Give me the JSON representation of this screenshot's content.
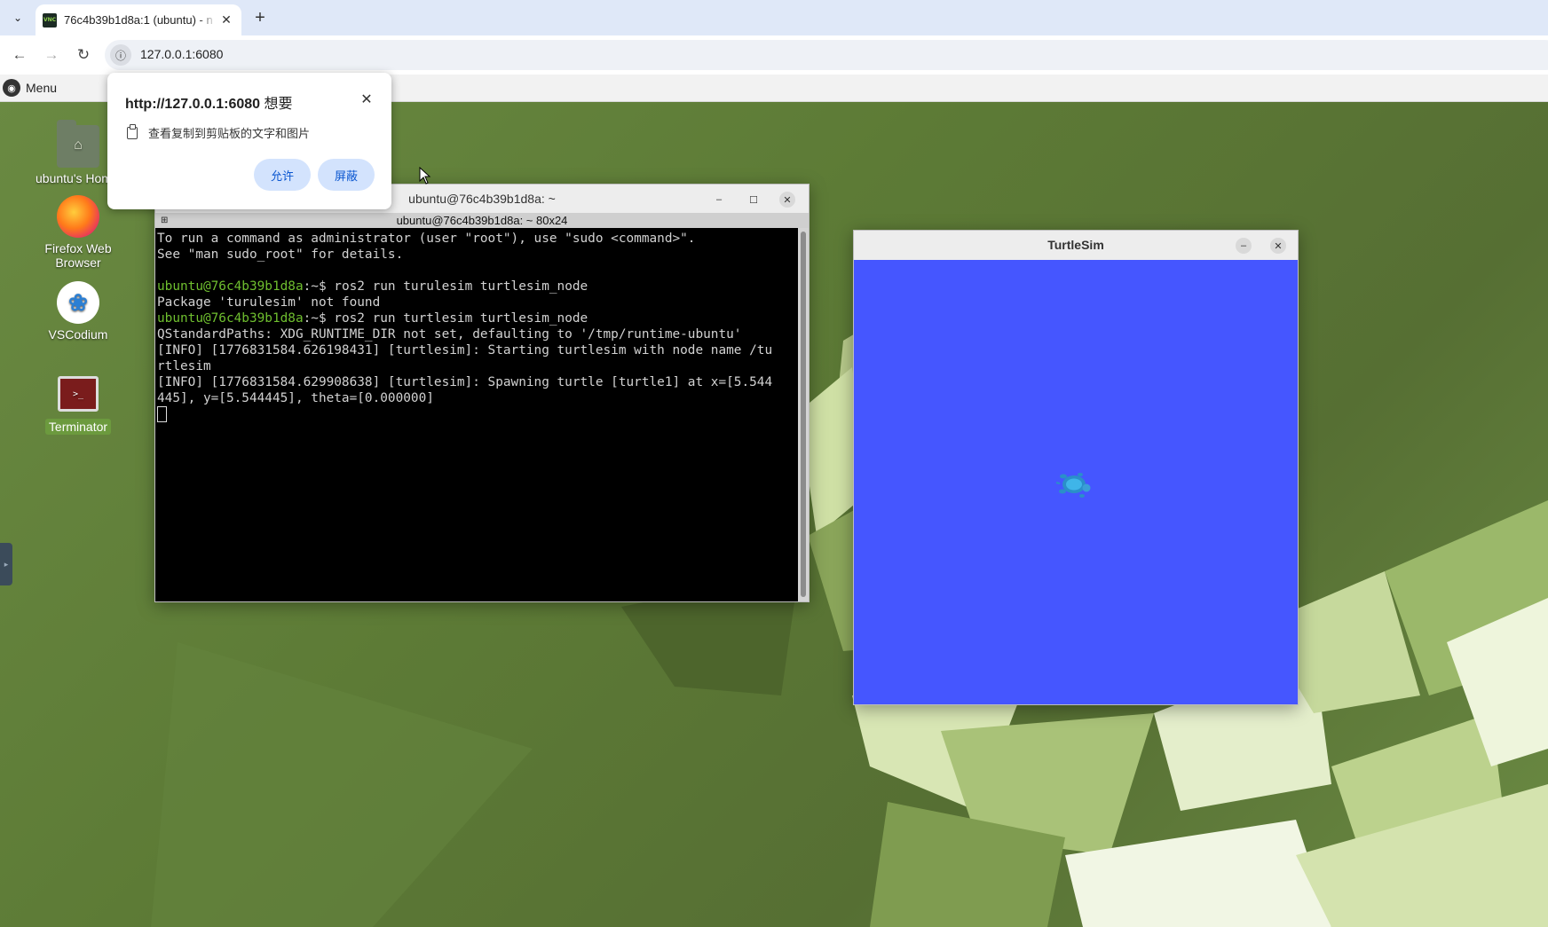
{
  "browser": {
    "tab_title": "76c4b39b1d8a:1 (ubuntu) - n",
    "favicon_text": "VNC",
    "url": "127.0.0.1:6080",
    "icons": [
      "tab-search-icon",
      "close-icon",
      "plus-icon",
      "back-icon",
      "forward-icon",
      "reload-icon",
      "site-info-icon"
    ]
  },
  "permission_popup": {
    "origin": "http://127.0.0.1:6080",
    "wants": "想要",
    "description": "查看复制到剪贴板的文字和图片",
    "allow_label": "允许",
    "block_label": "屏蔽"
  },
  "desktop": {
    "menu_label": "Menu",
    "icons": [
      {
        "label": "ubuntu's Home"
      },
      {
        "label": "Firefox Web Browser"
      },
      {
        "label": "VSCodium"
      },
      {
        "label": "Terminator"
      }
    ]
  },
  "terminal": {
    "window_title": "ubuntu@76c4b39b1d8a: ~",
    "subtitle": "ubuntu@76c4b39b1d8a: ~ 80x24",
    "lines": [
      {
        "user": "",
        "text": "To run a command as administrator (user \"root\"), use \"sudo <command>\"."
      },
      {
        "user": "",
        "text": "See \"man sudo_root\" for details."
      },
      {
        "user": "",
        "text": ""
      },
      {
        "user": "ubuntu@76c4b39b1d8a",
        "text": ":~$ ros2 run turulesim turtlesim_node"
      },
      {
        "user": "",
        "text": "Package 'turulesim' not found"
      },
      {
        "user": "ubuntu@76c4b39b1d8a",
        "text": ":~$ ros2 run turtlesim turtlesim_node"
      },
      {
        "user": "",
        "text": "QStandardPaths: XDG_RUNTIME_DIR not set, defaulting to '/tmp/runtime-ubuntu'"
      },
      {
        "user": "",
        "text": "[INFO] [1776831584.626198431] [turtlesim]: Starting turtlesim with node name /tu"
      },
      {
        "user": "",
        "text": "rtlesim"
      },
      {
        "user": "",
        "text": "[INFO] [1776831584.629908638] [turtlesim]: Spawning turtle [turtle1] at x=[5.544"
      },
      {
        "user": "",
        "text": "445], y=[5.544445], theta=[0.000000]"
      }
    ]
  },
  "turtlesim": {
    "window_title": "TurtleSim",
    "background_color": "#4556ff"
  }
}
